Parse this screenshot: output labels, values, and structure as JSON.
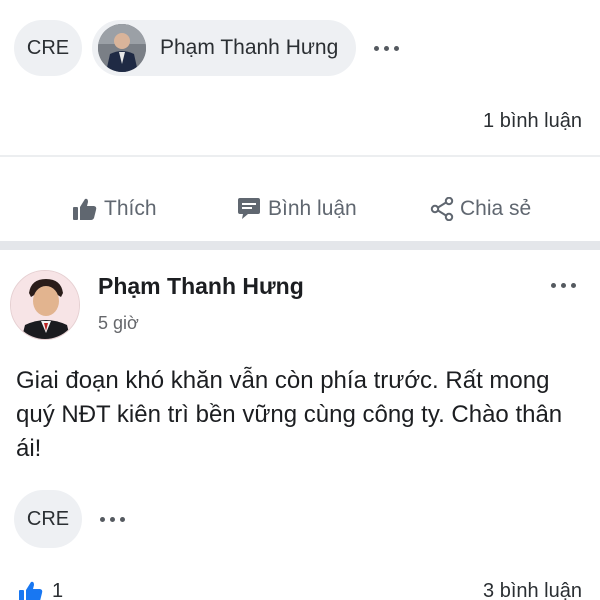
{
  "top_tags": {
    "page_tag": "CRE",
    "user_tag": "Phạm Thanh Hưng"
  },
  "shared_post": {
    "comment_count": "1 bình luận"
  },
  "actions": {
    "like": "Thích",
    "comment": "Bình luận",
    "share": "Chia sẻ"
  },
  "comment": {
    "author": "Phạm Thanh Hưng",
    "time": "5 giờ",
    "text": "Giai đoạn khó khăn vẫn còn phía trước. Rất mong quý NĐT kiên trì bền vững cùng công ty. Chào thân ái!",
    "tag": "CRE",
    "like_count": "1",
    "reply_count": "3 bình luận"
  },
  "colors": {
    "like_blue": "#1877f2",
    "icon_gray": "#606770"
  }
}
